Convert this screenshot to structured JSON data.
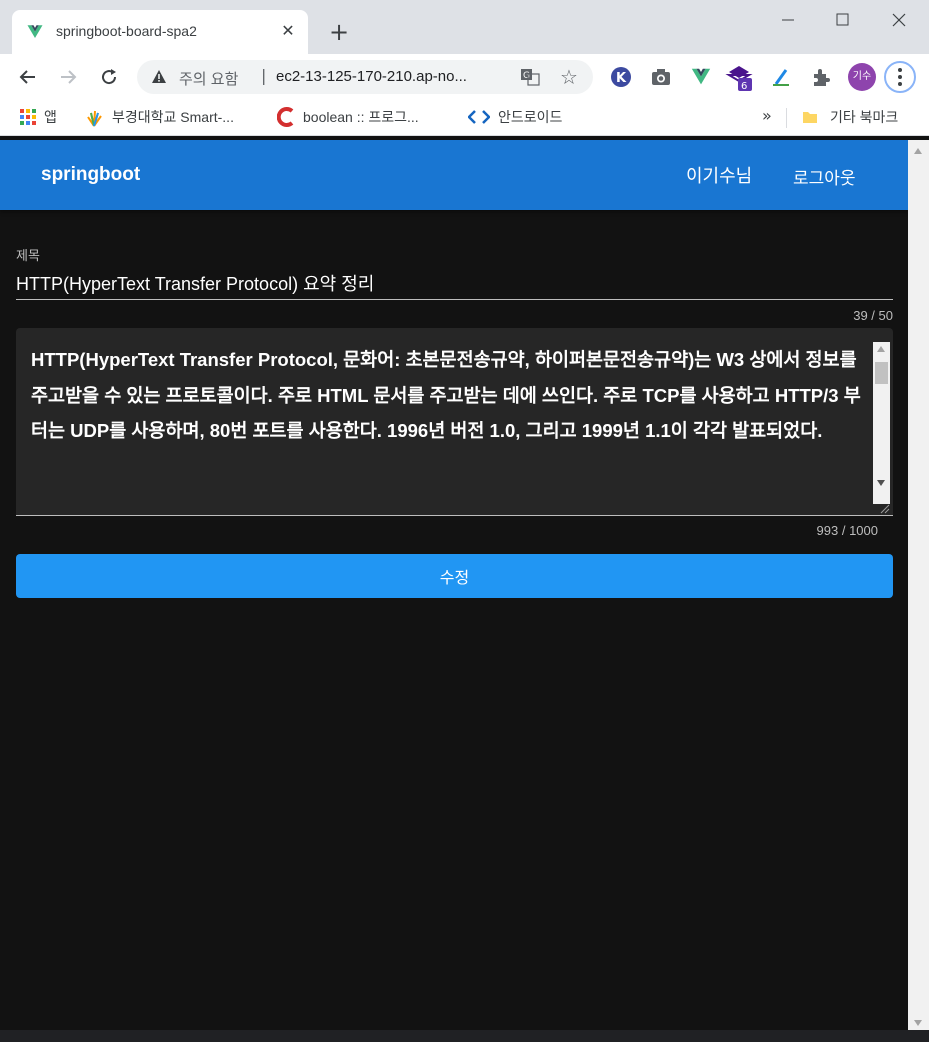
{
  "browser": {
    "tab_title": "springboot-board-spa2",
    "security_label": "주의 요함",
    "url": "ec2-13-125-170-210.ap-no...",
    "profile_initials": "기수",
    "extension_badge": "6",
    "bookmarks": [
      {
        "label": "앱",
        "icon": "apps-grid-icon"
      },
      {
        "label": "부경대학교 Smart-...",
        "icon": "hand-logo-icon"
      },
      {
        "label": "boolean :: 프로그...",
        "icon": "c-logo-icon"
      },
      {
        "label": "안드로이드",
        "icon": "code-brackets-icon"
      }
    ],
    "bookmarks_overflow": "»",
    "other_bookmarks": "기타 북마크"
  },
  "app": {
    "brand": "springboot",
    "user_name": "이기수님",
    "logout_label": "로그아웃",
    "primary_color": "#1976d2"
  },
  "form": {
    "title_label": "제목",
    "title_value": "HTTP(HyperText Transfer Protocol) 요약 정리",
    "title_counter": "39 / 50",
    "content_value": "HTTP(HyperText Transfer Protocol, 문화어: 초본문전송규약, 하이퍼본문전송규약)는 W3 상에서 정보를 주고받을 수 있는 프로토콜이다. 주로 HTML 문서를 주고받는 데에 쓰인다. 주로 TCP를 사용하고 HTTP/3 부터는 UDP를 사용하며, 80번 포트를 사용한다. 1996년 버전 1.0, 그리고 1999년 1.1이 각각 발표되었다.",
    "content_counter": "993 / 1000",
    "submit_label": "수정",
    "button_color": "#2196f3"
  }
}
